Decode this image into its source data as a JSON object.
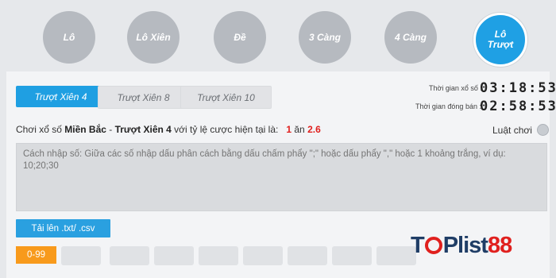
{
  "top_nav": {
    "items": [
      {
        "label": "Lô"
      },
      {
        "label": "Lô Xiên"
      },
      {
        "label": "Đề"
      },
      {
        "label": "3 Càng"
      },
      {
        "label": "4 Càng"
      },
      {
        "label": "Lô Trượt",
        "active": true
      }
    ]
  },
  "sub_tabs": [
    {
      "label": "Trượt Xiên 4",
      "active": true
    },
    {
      "label": "Trượt Xiên 8"
    },
    {
      "label": "Trượt Xiên 10"
    }
  ],
  "timers": {
    "lottery_label": "Thời gian xổ số :",
    "lottery_value": "03:18:53",
    "close_label": "Thời gian đóng bán :",
    "close_value": "02:58:53"
  },
  "info": {
    "prefix": "Chơi xổ số ",
    "region": "Miền Bắc",
    "dash": " - ",
    "game": "Trượt Xiên 4",
    "middle": " với tỷ lệ cược hiện tại là:",
    "ratio_left": "1",
    "ratio_word": "ăn",
    "ratio_right": "2.6"
  },
  "rules": {
    "label": "Luật chơi",
    "icon": "rules-icon"
  },
  "input": {
    "placeholder": "Cách nhập số: Giữa các số nhập dấu phân cách bằng dấu chấm phẩy \";\" hoặc dấu phẩy \",\" hoặc 1 khoảng trắng, ví dụ: 10;20;30"
  },
  "upload": {
    "label": "Tải lên .txt/ .csv"
  },
  "range": {
    "label": "0-99"
  },
  "watermark": {
    "text_left": "T",
    "text_mid": "Plist",
    "text_right": "88"
  },
  "colors": {
    "accent": "#1f9fe2",
    "orange": "#f89a1c",
    "red": "#e0201e"
  }
}
